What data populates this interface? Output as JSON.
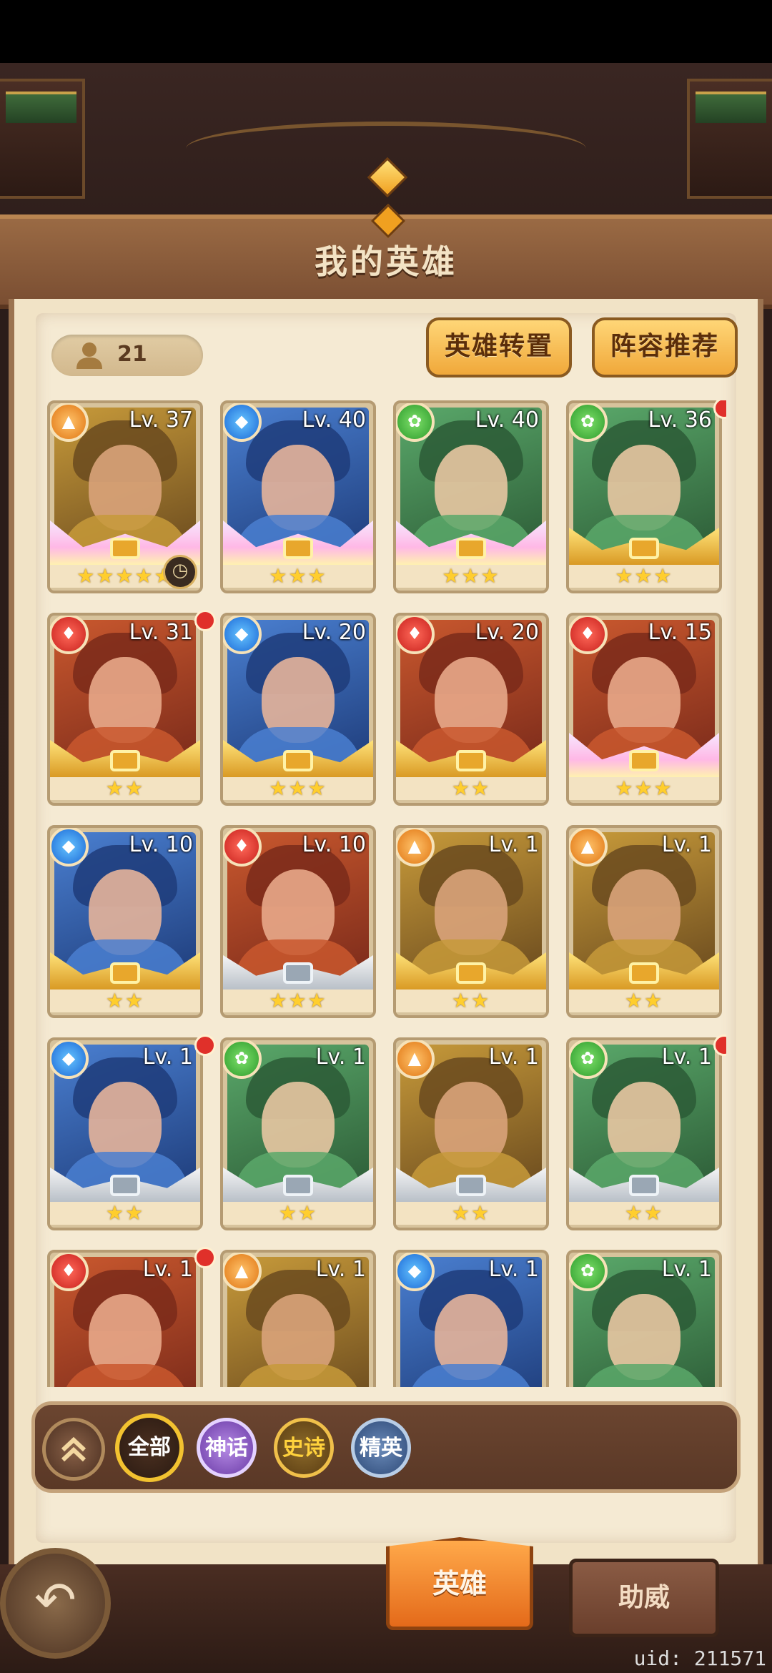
{
  "header": {
    "title": "我的英雄"
  },
  "toolbar": {
    "hero_count": "21",
    "hero_transfer_label": "英雄转置",
    "lineup_recommend_label": "阵容推荐"
  },
  "heroes": [
    {
      "level": "Lv. 37",
      "element": "earth",
      "stars": "★★★★★",
      "frame": "rainbow",
      "red_dot": false,
      "timer": true
    },
    {
      "level": "Lv. 40",
      "element": "water",
      "stars": "★★★",
      "frame": "rainbow",
      "red_dot": false,
      "timer": false
    },
    {
      "level": "Lv. 40",
      "element": "wind",
      "stars": "★★★",
      "frame": "rainbow",
      "red_dot": false,
      "timer": false
    },
    {
      "level": "Lv. 36",
      "element": "wind",
      "stars": "★★★",
      "frame": "gold",
      "red_dot": true,
      "timer": false
    },
    {
      "level": "Lv. 31",
      "element": "fire",
      "stars": "★★",
      "frame": "gold",
      "red_dot": true,
      "timer": false
    },
    {
      "level": "Lv. 20",
      "element": "water",
      "stars": "★★★",
      "frame": "gold",
      "red_dot": false,
      "timer": false
    },
    {
      "level": "Lv. 20",
      "element": "fire",
      "stars": "★★",
      "frame": "gold",
      "red_dot": false,
      "timer": false
    },
    {
      "level": "Lv. 15",
      "element": "fire",
      "stars": "★★★",
      "frame": "rainbow",
      "red_dot": false,
      "timer": false
    },
    {
      "level": "Lv. 10",
      "element": "water",
      "stars": "★★",
      "frame": "gold",
      "red_dot": false,
      "timer": false
    },
    {
      "level": "Lv. 10",
      "element": "fire",
      "stars": "★★★",
      "frame": "silver",
      "red_dot": false,
      "timer": false
    },
    {
      "level": "Lv. 1",
      "element": "earth",
      "stars": "★★",
      "frame": "gold",
      "red_dot": false,
      "timer": false
    },
    {
      "level": "Lv. 1",
      "element": "earth",
      "stars": "★★",
      "frame": "gold",
      "red_dot": false,
      "timer": false
    },
    {
      "level": "Lv. 1",
      "element": "water",
      "stars": "★★",
      "frame": "silver",
      "red_dot": true,
      "timer": false
    },
    {
      "level": "Lv. 1",
      "element": "wind",
      "stars": "★★",
      "frame": "silver",
      "red_dot": false,
      "timer": false
    },
    {
      "level": "Lv. 1",
      "element": "earth",
      "stars": "★★",
      "frame": "silver",
      "red_dot": false,
      "timer": false
    },
    {
      "level": "Lv. 1",
      "element": "wind",
      "stars": "★★",
      "frame": "silver",
      "red_dot": true,
      "timer": false
    },
    {
      "level": "Lv. 1",
      "element": "fire",
      "stars": "",
      "frame": "none",
      "red_dot": true,
      "timer": false
    },
    {
      "level": "Lv. 1",
      "element": "earth",
      "stars": "",
      "frame": "none",
      "red_dot": false,
      "timer": false
    },
    {
      "level": "Lv. 1",
      "element": "water",
      "stars": "",
      "frame": "none",
      "red_dot": false,
      "timer": false
    },
    {
      "level": "Lv. 1",
      "element": "wind",
      "stars": "",
      "frame": "none",
      "red_dot": false,
      "timer": false
    }
  ],
  "filters": {
    "all_label": "全部",
    "myth_label": "神话",
    "epic_label": "史诗",
    "elite_label": "精英"
  },
  "bottom_tabs": {
    "heroes_label": "英雄",
    "support_label": "助威"
  },
  "uid_text": "uid: 211571",
  "colors": {
    "fire": "#d8261e",
    "water": "#1f74de",
    "wind": "#2fa52f",
    "earth": "#e8851a",
    "accent_gold": "#f2c230"
  },
  "icons": {
    "back": "back-arrow-icon",
    "collapse": "double-chevron-up-icon",
    "person": "person-icon",
    "timer": "clock-icon"
  }
}
